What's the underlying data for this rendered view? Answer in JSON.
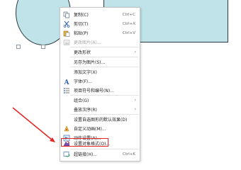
{
  "context_menu": {
    "items": [
      {
        "label": "复制(C)",
        "shortcut": "Ctrl+C",
        "icon": "copy-icon"
      },
      {
        "label": "剪切(T)",
        "shortcut": "Ctrl+X",
        "icon": "cut-icon"
      },
      {
        "label": "粘贴(P)",
        "shortcut": "Ctrl+V",
        "icon": "paste-icon"
      },
      {
        "label": "更改图片(A)...",
        "icon": "change-picture-icon",
        "disabled": true
      },
      {
        "label": "更改形状",
        "submenu": true
      },
      {
        "label": "另存为图片(S)..."
      },
      {
        "label": "添加文字(X)"
      },
      {
        "label": "字体(F)...",
        "icon": "font-icon"
      },
      {
        "label": "项目符号和编号(N)...",
        "icon": "bullets-icon"
      },
      {
        "label": "组合(G)",
        "submenu": true
      },
      {
        "label": "叠放次序(R)",
        "submenu": true
      },
      {
        "label": "设置自选图形的默认效果(D)"
      },
      {
        "label": "自定义动画(M)...",
        "icon": "animation-icon"
      },
      {
        "label": "动作设置(A)...",
        "icon": "action-icon"
      },
      {
        "label": "设置对象格式(O)...",
        "icon": "format-object-icon"
      },
      {
        "label": "超链接(H)...",
        "shortcut": "Ctrl+K",
        "icon": "hyperlink-icon"
      }
    ],
    "submenu_arrow": "›"
  },
  "colors": {
    "shape_fill": "#bfe3e8",
    "shape_border": "#2a3a40",
    "highlight": "#e32626"
  }
}
